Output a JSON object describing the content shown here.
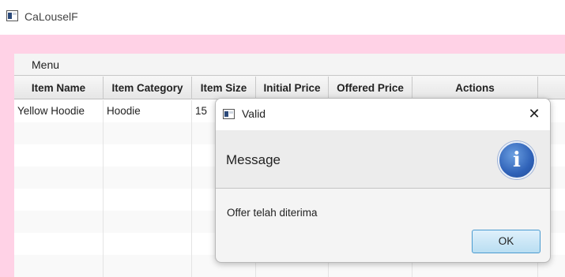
{
  "window": {
    "title": "CaLouselF"
  },
  "menubar": {
    "menu_label": "Menu"
  },
  "table": {
    "columns": [
      "Item Name",
      "Item Category",
      "Item Size",
      "Initial Price",
      "Offered Price",
      "Actions"
    ],
    "rows": [
      [
        "Yellow Hoodie",
        "Hoodie",
        "15",
        "",
        "",
        ""
      ]
    ]
  },
  "dialog": {
    "title": "Valid",
    "header": "Message",
    "content": "Offer telah diterima",
    "ok_label": "OK",
    "close_glyph": "✕",
    "info_glyph": "i"
  },
  "colors": {
    "pink_frame": "#ffd2e6",
    "ok_button_border": "#4a9bd0",
    "info_icon": "#2f62b8"
  }
}
